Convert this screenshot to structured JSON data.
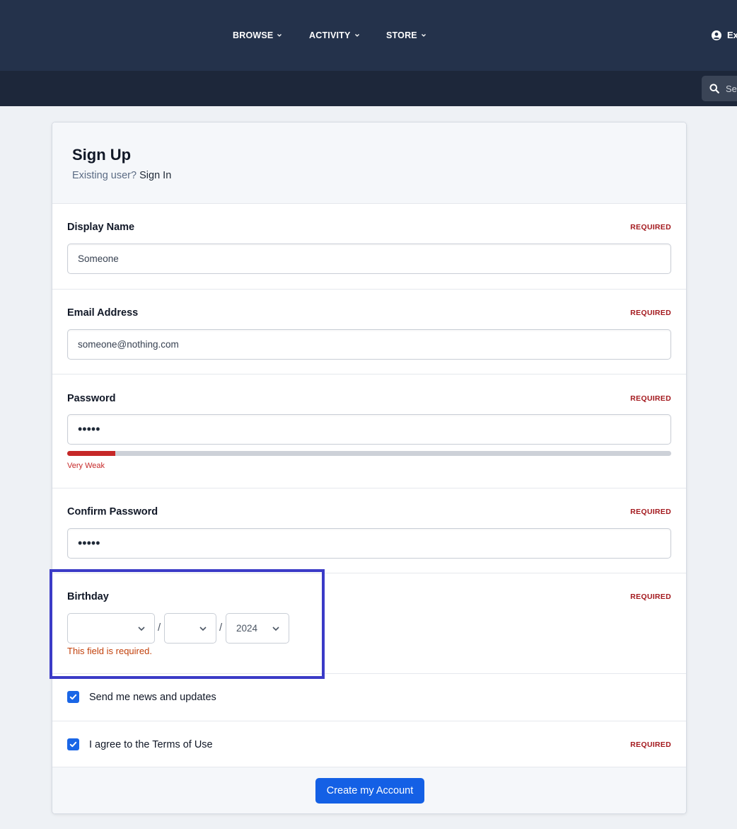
{
  "header": {
    "nav": [
      {
        "label": "BROWSE"
      },
      {
        "label": "ACTIVITY"
      },
      {
        "label": "STORE"
      }
    ],
    "user_label": "Ex",
    "search_placeholder": "Se"
  },
  "form": {
    "title": "Sign Up",
    "existing_prompt": "Existing user?",
    "sign_in_link": "Sign In",
    "required_label": "REQUIRED",
    "display_name": {
      "label": "Display Name",
      "value": "Someone"
    },
    "email": {
      "label": "Email Address",
      "value": "someone@nothing.com"
    },
    "password": {
      "label": "Password",
      "value": "•••••",
      "strength_text": "Very Weak",
      "strength_fraction": 0.08
    },
    "confirm_password": {
      "label": "Confirm Password",
      "value": "•••••"
    },
    "birthday": {
      "label": "Birthday",
      "month": "",
      "day": "",
      "year": "2024",
      "separator": "/",
      "error": "This field is required."
    },
    "news_checkbox": {
      "label": "Send me news and updates",
      "checked": true
    },
    "terms_checkbox": {
      "label_prefix": "I agree to the ",
      "link": "Terms of Use",
      "checked": true
    },
    "submit_label": "Create my Account"
  },
  "colors": {
    "header_bg": "#24324b",
    "subbar_bg": "#1d273a",
    "accent": "#1460e5",
    "required": "#a3181d",
    "error": "#c2410c",
    "strength_weak": "#c62828",
    "highlight": "#3b3bc7"
  }
}
